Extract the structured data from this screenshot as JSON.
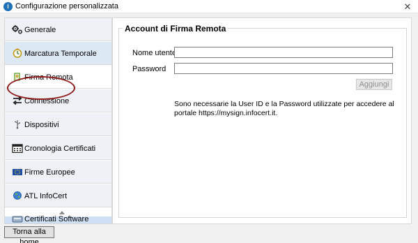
{
  "window": {
    "title": "Configurazione personalizzata",
    "close_symbol": "✕",
    "app_icon_letter": "i"
  },
  "sidebar": {
    "items": [
      {
        "label": "Generale",
        "icon": "gears-icon",
        "state": "normal"
      },
      {
        "label": "Marcatura Temporale",
        "icon": "timestamp-clock-icon",
        "state": "hover"
      },
      {
        "label": "Firma Remota",
        "icon": "remote-signature-icon",
        "state": "active"
      },
      {
        "label": "Connessione",
        "icon": "connection-arrows-icon",
        "state": "normal"
      },
      {
        "label": "Dispositivi",
        "icon": "usb-icon",
        "state": "normal"
      },
      {
        "label": "Cronologia Certificati",
        "icon": "calendar-icon",
        "state": "normal"
      },
      {
        "label": "Firme Europee",
        "icon": "eu-flag-icon",
        "state": "normal"
      },
      {
        "label": "ATL InfoCert",
        "icon": "globe-icon",
        "state": "normal"
      },
      {
        "label": "Certificati Software",
        "icon": "software-certificate-icon",
        "state": "normal"
      }
    ],
    "highlighted_item": "Firma Remota"
  },
  "content": {
    "section_title": "Account di Firma Remota",
    "username_label": "Nome utente",
    "username_value": "",
    "password_label": "Password",
    "password_value": "",
    "add_button_label": "Aggiungi",
    "info_text": "Sono necessarie la User ID e la Password utilizzate per accedere al portale https://mysign.infocert.it."
  },
  "footer": {
    "home_button_label": "Torna alla home"
  },
  "colors": {
    "highlight_ring": "#8e1b1b",
    "hover_item": "#dde8f5",
    "app_icon": "#1d70b7"
  }
}
